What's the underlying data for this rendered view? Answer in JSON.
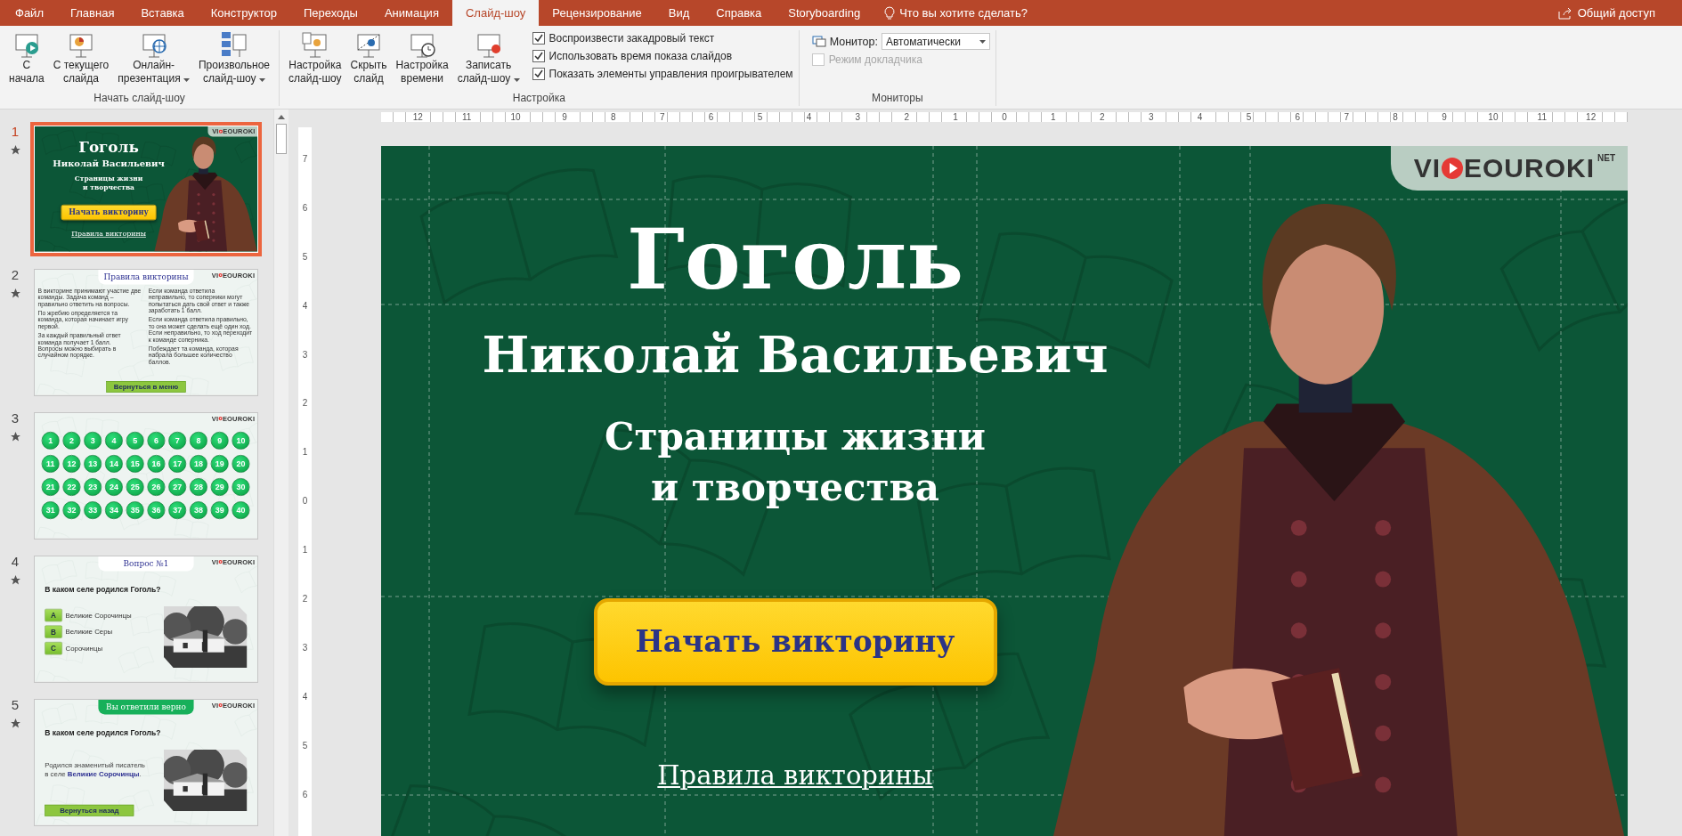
{
  "tabs": [
    {
      "label": "Файл",
      "selected": false
    },
    {
      "label": "Главная",
      "selected": false
    },
    {
      "label": "Вставка",
      "selected": false
    },
    {
      "label": "Конструктор",
      "selected": false
    },
    {
      "label": "Переходы",
      "selected": false
    },
    {
      "label": "Анимация",
      "selected": false
    },
    {
      "label": "Слайд-шоу",
      "selected": true
    },
    {
      "label": "Рецензирование",
      "selected": false
    },
    {
      "label": "Вид",
      "selected": false
    },
    {
      "label": "Справка",
      "selected": false
    },
    {
      "label": "Storyboarding",
      "selected": false
    }
  ],
  "tell_me": "Что вы хотите сделать?",
  "share": "Общий доступ",
  "ribbon": {
    "groups": [
      {
        "label": "Начать слайд-шоу",
        "buttons": [
          {
            "label": "С\nначала",
            "kind": "play",
            "dropdown": false
          },
          {
            "label": "С текущего\nслайда",
            "kind": "chart",
            "dropdown": false
          },
          {
            "label": "Онлайн-\nпрезентация",
            "kind": "globe",
            "dropdown": true
          },
          {
            "label": "Произвольное\nслайд-шоу",
            "kind": "list",
            "dropdown": true
          }
        ]
      },
      {
        "label": "Настройка",
        "buttons": [
          {
            "label": "Настройка\nслайд-шоу",
            "kind": "setup",
            "dropdown": false
          },
          {
            "label": "Скрыть\nслайд",
            "kind": "hide",
            "dropdown": false
          },
          {
            "label": "Настройка\nвремени",
            "kind": "timer",
            "dropdown": false
          },
          {
            "label": "Записать\nслайд-шоу",
            "kind": "record",
            "dropdown": true
          }
        ],
        "checkboxes": [
          {
            "label": "Воспроизвести закадровый текст",
            "checked": true,
            "disabled": false
          },
          {
            "label": "Использовать время показа слайдов",
            "checked": true,
            "disabled": false
          },
          {
            "label": "Показать элементы управления проигрывателем",
            "checked": true,
            "disabled": false
          }
        ]
      },
      {
        "label": "Мониторы",
        "monitor": {
          "label": "Монитор:",
          "value": "Автоматически"
        },
        "checkboxes": [
          {
            "label": "Режим докладчика",
            "checked": false,
            "disabled": true
          }
        ]
      }
    ]
  },
  "slides": [
    {
      "number": "1",
      "selected": true,
      "animated": true,
      "kind": "title",
      "logo": {
        "before": "VI",
        "after": "EOUROKI"
      },
      "title": "Гоголь",
      "subtitle": "Николай Васильевич",
      "tagline": "Страницы жизни\nи творчества",
      "button": "Начать викторину",
      "link": "Правила викторины"
    },
    {
      "number": "2",
      "selected": false,
      "animated": true,
      "kind": "rules",
      "logo": {
        "before": "VI",
        "after": "EOUROKI"
      },
      "title": "Правила викторины",
      "columns": [
        [
          "В викторине принимают участие две команды. Задача команд – правильно ответить на вопросы.",
          "По жребию определяется та команда, которая начинает игру первой.",
          "За каждый правильный ответ команда получает 1 балл.\nВопросы можно выбирать в случайном порядке."
        ],
        [
          "Если команда ответила неправильно, то соперники могут попытаться дать свой ответ и также заработать 1 балл.",
          "Если команда ответила правильно, то она может сделать ещё один ход.\nЕсли неправильно, то ход переходит к команде соперника.",
          "Побеждает та команда, которая набрала большее количество баллов."
        ]
      ],
      "button": "Вернуться в меню"
    },
    {
      "number": "3",
      "selected": false,
      "animated": true,
      "kind": "grid",
      "logo": {
        "before": "VI",
        "after": "EOUROKI"
      },
      "cells": [
        "1",
        "2",
        "3",
        "4",
        "5",
        "6",
        "7",
        "8",
        "9",
        "10",
        "11",
        "12",
        "13",
        "14",
        "15",
        "16",
        "17",
        "18",
        "19",
        "20",
        "21",
        "22",
        "23",
        "24",
        "25",
        "26",
        "27",
        "28",
        "29",
        "30",
        "31",
        "32",
        "33",
        "34",
        "35",
        "36",
        "37",
        "38",
        "39",
        "40"
      ]
    },
    {
      "number": "4",
      "selected": false,
      "animated": true,
      "kind": "question",
      "logo": {
        "before": "VI",
        "after": "EOUROKI"
      },
      "title": "Вопрос №1",
      "question": "В каком селе родился Гоголь?",
      "answers": [
        {
          "letter": "A",
          "text": "Великие Сорочинцы"
        },
        {
          "letter": "B",
          "text": "Великие Серы"
        },
        {
          "letter": "C",
          "text": "Сорочинцы"
        }
      ]
    },
    {
      "number": "5",
      "selected": false,
      "animated": true,
      "kind": "answer",
      "logo": {
        "before": "VI",
        "after": "EOUROKI"
      },
      "title": "Вы ответили верно",
      "question": "В каком селе родился Гоголь?",
      "text": "Родился знаменитый писатель\nв селе **Великие Сорочинцы**.",
      "button": "Вернуться назад"
    }
  ],
  "rulers": {
    "horizontal": [
      "12",
      "11",
      "10",
      "9",
      "8",
      "7",
      "6",
      "5",
      "4",
      "3",
      "2",
      "1",
      "0",
      "1",
      "2",
      "3",
      "4",
      "5",
      "6",
      "7",
      "8",
      "9",
      "10",
      "11",
      "12"
    ],
    "vertical": [
      "7",
      "6",
      "5",
      "4",
      "3",
      "2",
      "1",
      "0",
      "1",
      "2",
      "3",
      "4",
      "5",
      "6"
    ]
  },
  "editor": {
    "kind": "title",
    "logo": {
      "before": "VI",
      "after": "EOUROKI",
      "suffix": "NET"
    },
    "title": "Гоголь",
    "subtitle": "Николай Васильевич",
    "tagline": "Страницы жизни\nи творчества",
    "button": "Начать викторину",
    "link": "Правила викторины"
  }
}
